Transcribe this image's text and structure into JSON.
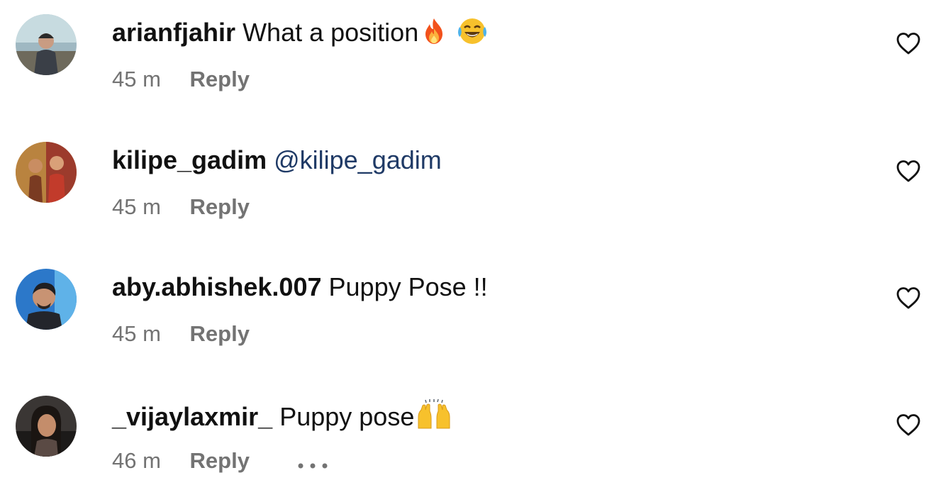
{
  "comments": [
    {
      "username": "arianfjahir",
      "text": "What a position",
      "emoji": [
        "fire-emoji",
        "tears-of-joy-emoji"
      ],
      "time": "45 m",
      "reply_label": "Reply"
    },
    {
      "username": "kilipe_gadim",
      "mention": "@kilipe_gadim",
      "time": "45 m",
      "reply_label": "Reply"
    },
    {
      "username": "aby.abhishek.007",
      "text": "Puppy Pose !!",
      "time": "45 m",
      "reply_label": "Reply"
    },
    {
      "username": "_vijaylaxmir_",
      "text": "Puppy pose",
      "emoji": [
        "raising-hands-emoji"
      ],
      "time": "46 m",
      "reply_label": "Reply",
      "more_icon": "more-options-icon"
    }
  ],
  "icons": {
    "like": "heart-outline-icon"
  },
  "colors": {
    "text_primary": "#111111",
    "text_secondary": "#737373",
    "mention": "#1f3a66",
    "background": "#ffffff"
  }
}
